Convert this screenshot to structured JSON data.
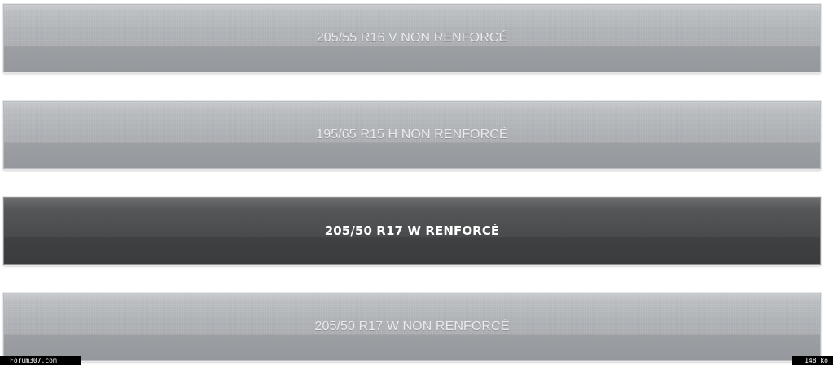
{
  "tire_options": [
    {
      "label": "205/55 R16 V NON RENFORCÉ",
      "selected": false
    },
    {
      "label": "195/65 R15 H NON RENFORCÉ",
      "selected": false
    },
    {
      "label": "205/50 R17 W RENFORCÉ",
      "selected": true
    },
    {
      "label": "205/50 R17 W NON RENFORCÉ",
      "selected": false
    }
  ],
  "footer": {
    "site": "Forum307.com",
    "file_size": "148 ko"
  },
  "colors": {
    "unselected_button": "#a9acb0",
    "selected_button": "#4a4b4d",
    "unselected_text": "#e9eaeb",
    "selected_text": "#ffffff"
  }
}
